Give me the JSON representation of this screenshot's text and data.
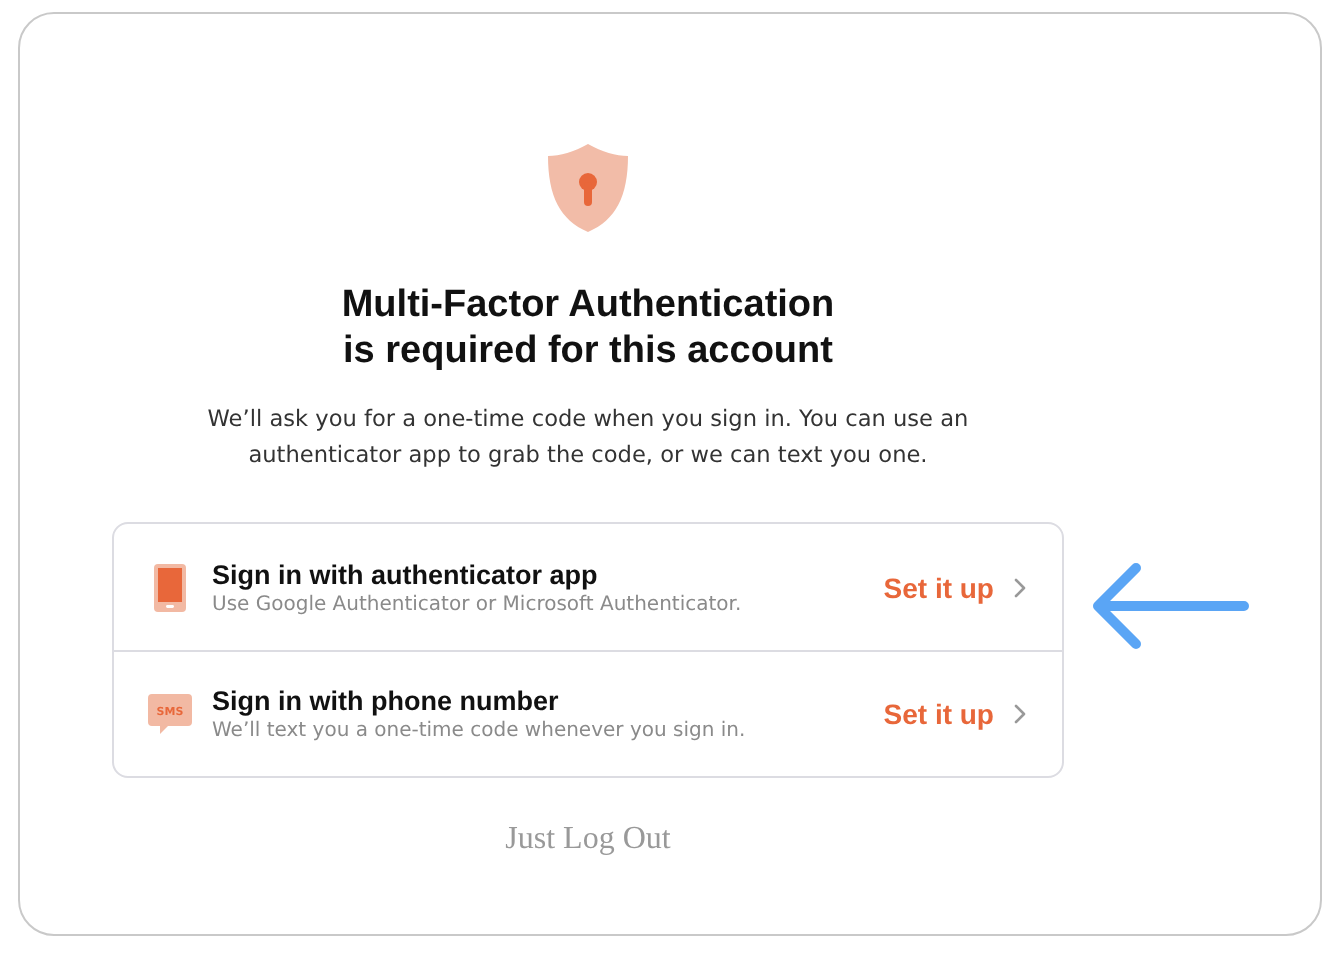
{
  "heading": {
    "lines": [
      "Multi-Factor Authentication",
      "is required for this account"
    ]
  },
  "description": "We’ll ask you for a one-time code when you sign in. You can use an authenticator app to grab the code, or we can text you one.",
  "options": [
    {
      "kind": "app",
      "title": "Sign in with authenticator app",
      "subtitle": "Use Google Authenticator or Microsoft Authenticator.",
      "action": "Set it up"
    },
    {
      "kind": "sms",
      "icon_label": "SMS",
      "title": "Sign in with phone number",
      "subtitle": "We’ll text you a one-time code whenever you sign in.",
      "action": "Set it up"
    }
  ],
  "logout": "Just Log Out"
}
